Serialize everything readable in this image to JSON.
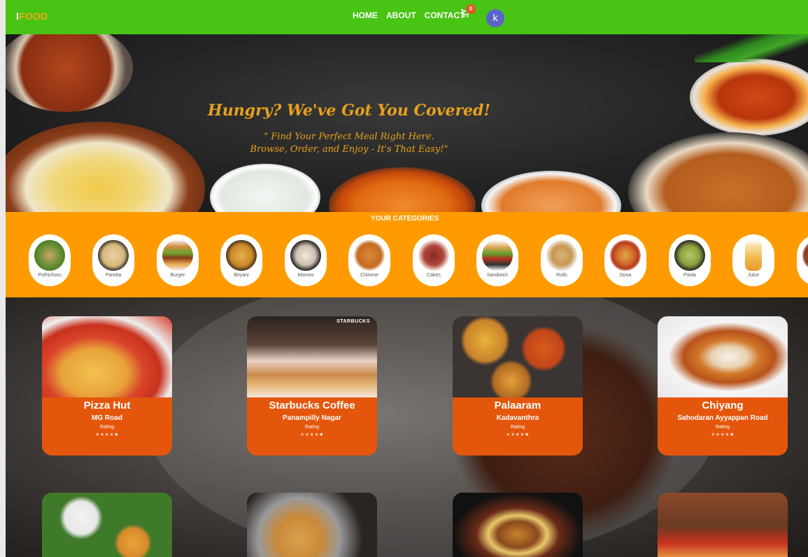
{
  "navbar": {
    "brand_bar": "I",
    "brand_word": "FOOD",
    "links": [
      "HOME",
      "ABOUT",
      "CONTACT"
    ],
    "cart_count": "0",
    "avatar_initial": "k"
  },
  "hero": {
    "title": "Hungry? We've Got You Covered!",
    "subtitle_line1": "\" Find Your Perfect Meal Right Here.",
    "subtitle_line2": "Browse, Order, and Enjoy - It's That Easy!\""
  },
  "categories": {
    "heading": "YOUR CATEGORIES",
    "items": [
      "Pothichoru",
      "Parotta",
      "Burger",
      "Biryani",
      "Momos",
      "Chinese",
      "Cakes",
      "Sandwich",
      "Rolls",
      "Dosa",
      "Pasta",
      "Juice",
      ""
    ]
  },
  "restaurants": [
    {
      "name": "Pizza Hut",
      "location": "MG Road",
      "rating_label": "Rating",
      "stars_dim": "★★★★",
      "stars_full": "★"
    },
    {
      "name": "Starbucks Coffee",
      "location": "Panampilly Nagar",
      "rating_label": "Rating",
      "stars_dim": "★★★★",
      "stars_full": "★",
      "image_brand": "STARBUCKS"
    },
    {
      "name": "Palaaram",
      "location": "Kadavanthra",
      "rating_label": "Rating",
      "stars_dim": "★★★★",
      "stars_full": "★"
    },
    {
      "name": "Chiyang",
      "location": "Sahodaran Ayyappan Road",
      "rating_label": "Rating",
      "stars_dim": "★★★★",
      "stars_full": "★"
    }
  ],
  "colors": {
    "navbar": "#48c414",
    "brand_accent": "#f7a21a",
    "categories_bg": "#ff9b00",
    "card_bg": "#e4560c",
    "hero_text": "#e7a21c",
    "avatar_bg": "#5a64c8",
    "badge_bg": "#e8541c"
  },
  "icons": {
    "cart": "cart-icon"
  }
}
